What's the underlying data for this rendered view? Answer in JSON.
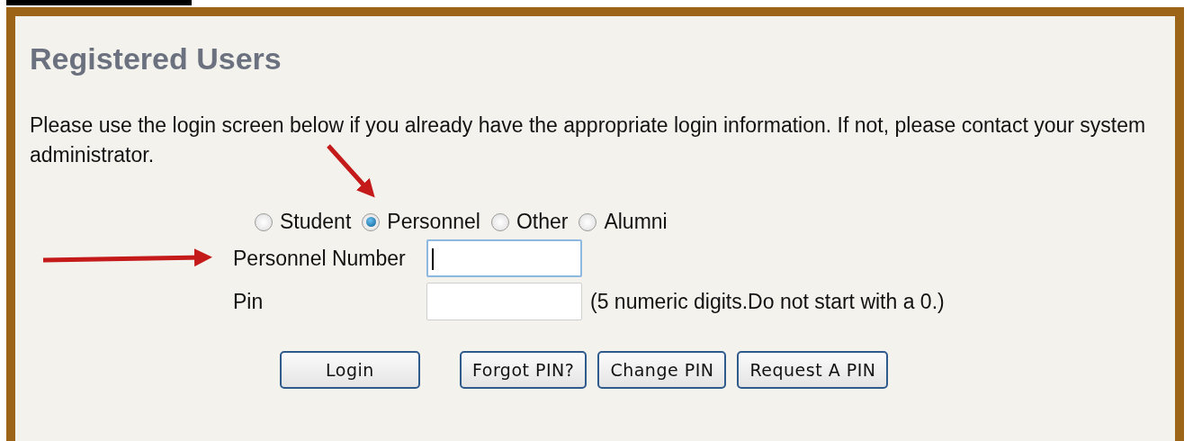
{
  "heading": "Registered Users",
  "intro": "Please use the login screen below if you already have the appropriate login information. If not, please contact your system administrator.",
  "user_types": [
    {
      "label": "Student",
      "selected": false
    },
    {
      "label": "Personnel",
      "selected": true
    },
    {
      "label": "Other",
      "selected": false
    },
    {
      "label": "Alumni",
      "selected": false
    }
  ],
  "fields": [
    {
      "label": "Personnel Number",
      "focused": true
    },
    {
      "label": "Pin",
      "focused": false,
      "hint": "(5 numeric digits.Do not start with a 0.)"
    }
  ],
  "buttons": [
    "Login",
    "Forgot PIN?",
    "Change PIN",
    "Request A PIN"
  ]
}
